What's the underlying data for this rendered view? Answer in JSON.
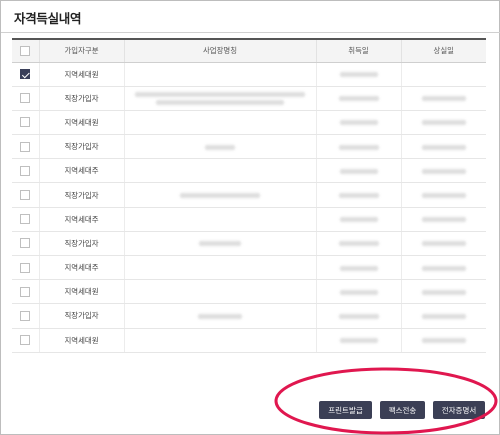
{
  "panel": {
    "title": "자격득실내역"
  },
  "table": {
    "headers": [
      "",
      "가입자구분",
      "사업장명칭",
      "취득일",
      "상실일"
    ],
    "rows": [
      {
        "checked": true,
        "type": "지역세대원",
        "name_w": 0,
        "acq_w": 38,
        "loss_w": 0
      },
      {
        "checked": false,
        "type": "직장가입자",
        "name_w": 170,
        "acq_w": 40,
        "loss_w": 44,
        "two_line": true
      },
      {
        "checked": false,
        "type": "지역세대원",
        "name_w": 0,
        "acq_w": 38,
        "loss_w": 44
      },
      {
        "checked": false,
        "type": "직장가입자",
        "name_w": 30,
        "acq_w": 40,
        "loss_w": 44
      },
      {
        "checked": false,
        "type": "지역세대주",
        "name_w": 0,
        "acq_w": 38,
        "loss_w": 44
      },
      {
        "checked": false,
        "type": "직장가입자",
        "name_w": 80,
        "acq_w": 40,
        "loss_w": 44
      },
      {
        "checked": false,
        "type": "지역세대주",
        "name_w": 0,
        "acq_w": 38,
        "loss_w": 44
      },
      {
        "checked": false,
        "type": "직장가입자",
        "name_w": 42,
        "acq_w": 40,
        "loss_w": 44
      },
      {
        "checked": false,
        "type": "지역세대주",
        "name_w": 0,
        "acq_w": 38,
        "loss_w": 44
      },
      {
        "checked": false,
        "type": "지역세대원",
        "name_w": 0,
        "acq_w": 38,
        "loss_w": 44
      },
      {
        "checked": false,
        "type": "직장가입자",
        "name_w": 44,
        "acq_w": 40,
        "loss_w": 44
      },
      {
        "checked": false,
        "type": "지역세대원",
        "name_w": 0,
        "acq_w": 38,
        "loss_w": 44
      }
    ]
  },
  "buttons": {
    "print": "프린트발급",
    "fax": "팩스전송",
    "cert": "전자증명서"
  },
  "colors": {
    "button_bg": "#3b3f55",
    "highlight": "#e0174f",
    "check_bg": "#3a3f5a"
  }
}
